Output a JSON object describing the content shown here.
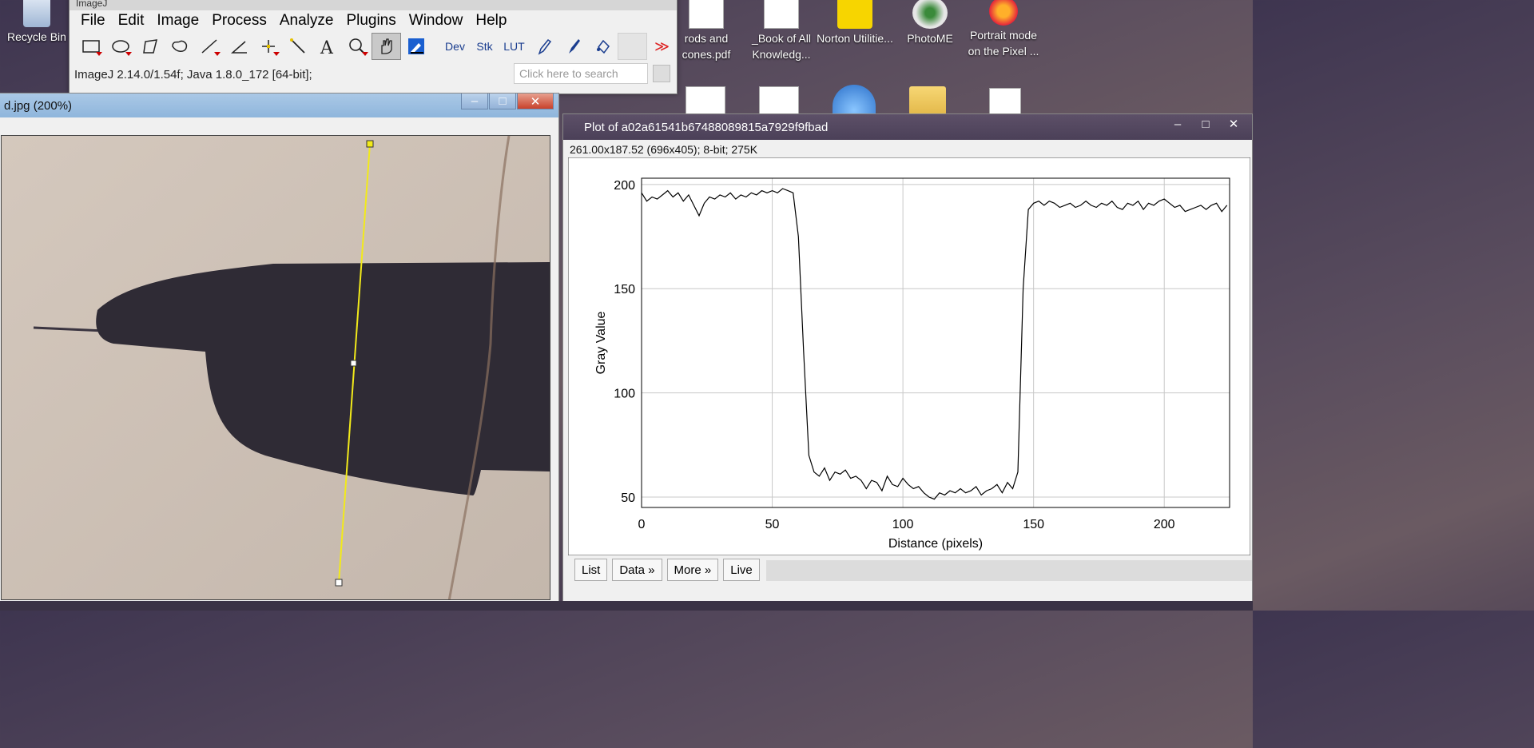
{
  "desktop": {
    "icons": [
      {
        "label": "Recycle Bin"
      },
      {
        "label": "rods and cones.pdf"
      },
      {
        "label": "_Book of All Knowledg..."
      },
      {
        "label": "Norton Utilitie..."
      },
      {
        "label": "PhotoME"
      },
      {
        "label": "Portrait mode on the Pixel ..."
      }
    ]
  },
  "imagej": {
    "title": "ImageJ",
    "menu": [
      "File",
      "Edit",
      "Image",
      "Process",
      "Analyze",
      "Plugins",
      "Window",
      "Help"
    ],
    "tools": [
      {
        "icon": "rectangle-select-icon"
      },
      {
        "icon": "oval-select-icon"
      },
      {
        "icon": "polygon-select-icon"
      },
      {
        "icon": "freehand-select-icon"
      },
      {
        "icon": "line-tool-icon"
      },
      {
        "icon": "angle-tool-icon"
      },
      {
        "icon": "point-tool-icon"
      },
      {
        "icon": "wand-tool-icon"
      },
      {
        "icon": "text-tool-icon"
      },
      {
        "icon": "magnifier-icon"
      },
      {
        "icon": "hand-tool-icon"
      },
      {
        "icon": "color-picker-icon"
      },
      {
        "label": "Dev"
      },
      {
        "label": "Stk"
      },
      {
        "label": "LUT"
      },
      {
        "icon": "pencil-icon"
      },
      {
        "icon": "brush-icon"
      },
      {
        "icon": "flood-fill-icon"
      }
    ],
    "status": "ImageJ 2.14.0/1.54f; Java 1.8.0_172 [64-bit];",
    "search_placeholder": "Click here to search",
    "more_glyph": "≫"
  },
  "image_window": {
    "title": "d.jpg (200%)"
  },
  "plot_window": {
    "title": "Plot of a02a61541b67488089815a7929f9fbad",
    "info": "261.00x187.52  (696x405); 8-bit; 275K",
    "buttons": [
      "List",
      "Data »",
      "More »",
      "Live"
    ]
  },
  "chart_data": {
    "type": "line",
    "xlabel": "Distance (pixels)",
    "ylabel": "Gray Value",
    "xlim": [
      0,
      225
    ],
    "ylim": [
      45,
      203
    ],
    "xticks": [
      0,
      50,
      100,
      150,
      200
    ],
    "yticks": [
      50,
      100,
      150,
      200
    ],
    "grid": true,
    "series": [
      {
        "x": [
          0,
          2,
          4,
          6,
          8,
          10,
          12,
          14,
          16,
          18,
          20,
          22,
          24,
          26,
          28,
          30,
          32,
          34,
          36,
          38,
          40,
          42,
          44,
          46,
          48,
          50,
          52,
          54,
          56,
          58,
          60,
          62,
          64,
          66,
          68,
          70,
          72,
          74,
          76,
          78,
          80,
          82,
          84,
          86,
          88,
          90,
          92,
          94,
          96,
          98,
          100,
          102,
          104,
          106,
          108,
          110,
          112,
          114,
          116,
          118,
          120,
          122,
          124,
          126,
          128,
          130,
          132,
          134,
          136,
          138,
          140,
          142,
          144,
          146,
          148,
          150,
          152,
          154,
          156,
          158,
          160,
          162,
          164,
          166,
          168,
          170,
          172,
          174,
          176,
          178,
          180,
          182,
          184,
          186,
          188,
          190,
          192,
          194,
          196,
          198,
          200,
          202,
          204,
          206,
          208,
          210,
          212,
          214,
          216,
          218,
          220,
          222,
          224
        ],
        "y": [
          196,
          192,
          194,
          193,
          195,
          197,
          194,
          196,
          192,
          195,
          190,
          185,
          191,
          194,
          193,
          195,
          194,
          196,
          193,
          195,
          194,
          196,
          195,
          197,
          196,
          197,
          196,
          198,
          197,
          196,
          175,
          120,
          70,
          62,
          60,
          64,
          58,
          62,
          61,
          63,
          59,
          60,
          58,
          54,
          58,
          57,
          53,
          60,
          56,
          55,
          59,
          56,
          54,
          55,
          52,
          50,
          49,
          52,
          51,
          53,
          52,
          54,
          52,
          53,
          55,
          51,
          53,
          54,
          56,
          52,
          57,
          54,
          62,
          150,
          188,
          191,
          192,
          190,
          192,
          191,
          189,
          190,
          191,
          189,
          190,
          192,
          190,
          189,
          191,
          190,
          192,
          189,
          188,
          191,
          190,
          192,
          188,
          191,
          190,
          192,
          193,
          191,
          189,
          190,
          187,
          188,
          189,
          190,
          188,
          190,
          191,
          187,
          190
        ]
      }
    ]
  },
  "colors": {
    "line_roi": "#f2ea1a",
    "plot_line": "#000000",
    "grid": "#c8c8c8",
    "shadow": "#2f2b35",
    "surface": "#cbbfb4"
  }
}
